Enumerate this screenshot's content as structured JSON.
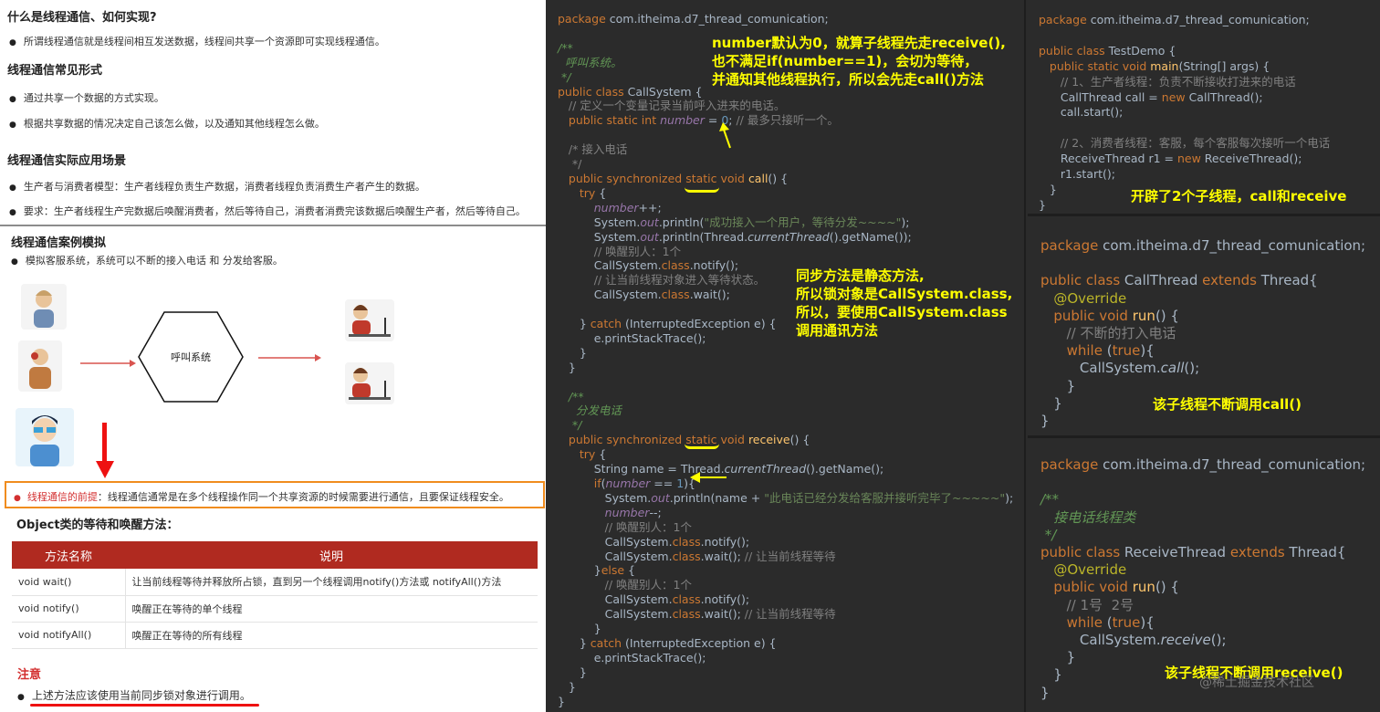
{
  "left": {
    "h1": "什么是线程通信、如何实现?",
    "b1": "所谓线程通信就是线程间相互发送数据，线程间共享一个资源即可实现线程通信。",
    "h2": "线程通信常见形式",
    "b2": "通过共享一个数据的方式实现。",
    "b3": "根据共享数据的情况决定自己该怎么做，以及通知其他线程怎么做。",
    "h3": "线程通信实际应用场景",
    "b4": "生产者与消费者模型：生产者线程负责生产数据，消费者线程负责消费生产者产生的数据。",
    "b5": "要求：生产者线程生产完数据后唤醒消费者，然后等待自己，消费者消费完该数据后唤醒生产者，然后等待自己。",
    "h4": "线程通信案例模拟",
    "b6": "模拟客服系统，系统可以不断的接入电话 和 分发给客服。",
    "hex": "呼叫系统",
    "premise_red": "线程通信的前提",
    "premise": "：线程通信通常是在多个线程操作同一个共享资源的时候需要进行通信，且要保证线程安全。",
    "obj_title": "Object类的等待和唤醒方法：",
    "th": [
      "方法名称",
      "说明"
    ],
    "rows": [
      [
        "void wait()",
        "让当前线程等待并释放所占锁，直到另一个线程调用notify()方法或 notifyAll()方法"
      ],
      [
        "void notify()",
        "唤醒正在等待的单个线程"
      ],
      [
        "void notifyAll()",
        "唤醒正在等待的所有线程"
      ]
    ],
    "note_title": "注意",
    "note": "上述方法应该使用当前同步锁对象进行调用。"
  },
  "mid": {
    "annot1": "number默认为0，就算子线程先走receive(),\n也不满足if(number==1)，会切为等待，\n并通知其他线程执行，所以会先走call()方法",
    "annot2": "同步方法是静态方法,\n所以锁对象是CallSystem.class,\n所以，要使用CallSystem.class\n调用通讯方法"
  },
  "right": {
    "annot_top": "开辟了2个子线程，call和receive",
    "annot_mid": "该子线程不断调用call()",
    "annot_bot": "该子线程不断调用receive()",
    "watermark": "@稀土掘金技术社区"
  },
  "colors": {
    "accent_red": "#d32f2f",
    "table_header": "#b02a20",
    "highlight": "#ffff00",
    "orange_box": "#f08c1e"
  }
}
